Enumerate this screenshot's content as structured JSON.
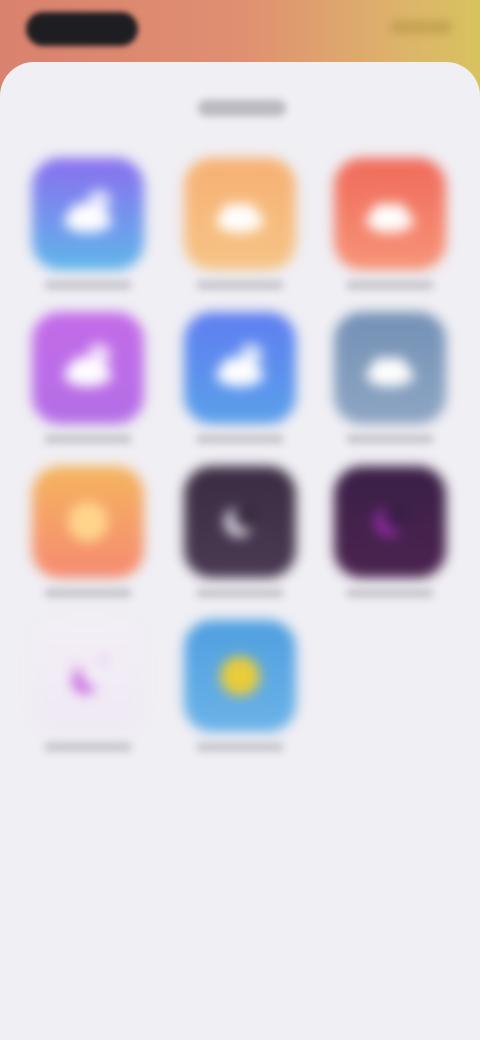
{
  "colors": {
    "wallpaper_left": "#d9826f",
    "wallpaper_right": "#d8c25e",
    "sheet_background": "#f0eff4"
  },
  "sheet": {
    "title": ""
  },
  "icons": [
    {
      "id": "icon-1",
      "label": "",
      "glyph": "cloud-moon-icon",
      "color_top": "#8a6ef0",
      "color_bottom": "#5fb6ea"
    },
    {
      "id": "icon-2",
      "label": "",
      "glyph": "cloud-icon",
      "color_top": "#f7b073",
      "color_bottom": "#f6c486"
    },
    {
      "id": "icon-3",
      "label": "",
      "glyph": "cloud-icon",
      "color_top": "#f06a5a",
      "color_bottom": "#f79478"
    },
    {
      "id": "icon-4",
      "label": "",
      "glyph": "cloud-moon-icon",
      "color_top": "#c36be8",
      "color_bottom": "#b46ee6"
    },
    {
      "id": "icon-5",
      "label": "",
      "glyph": "cloud-moon-icon",
      "color_top": "#5f7ef0",
      "color_bottom": "#5aa0ea"
    },
    {
      "id": "icon-6",
      "label": "",
      "glyph": "cloud-icon",
      "color_top": "#7390b5",
      "color_bottom": "#8ea6c3"
    },
    {
      "id": "icon-7",
      "label": "",
      "glyph": "sun-icon",
      "color_top": "#f5b55f",
      "color_bottom": "#f58a72"
    },
    {
      "id": "icon-8",
      "label": "",
      "glyph": "moon-icon",
      "color_top": "#3a2c42",
      "color_bottom": "#4a3a52"
    },
    {
      "id": "icon-9",
      "label": "",
      "glyph": "moon-icon",
      "color_top": "#3a1f46",
      "color_bottom": "#4b2450"
    },
    {
      "id": "icon-10",
      "label": "",
      "glyph": "moon-stars-icon",
      "color_top": "#f3eff6",
      "color_bottom": "#efe9f4"
    },
    {
      "id": "icon-11",
      "label": "",
      "glyph": "sun-icon",
      "color_top": "#4f9fe0",
      "color_bottom": "#6bb3e8"
    }
  ]
}
